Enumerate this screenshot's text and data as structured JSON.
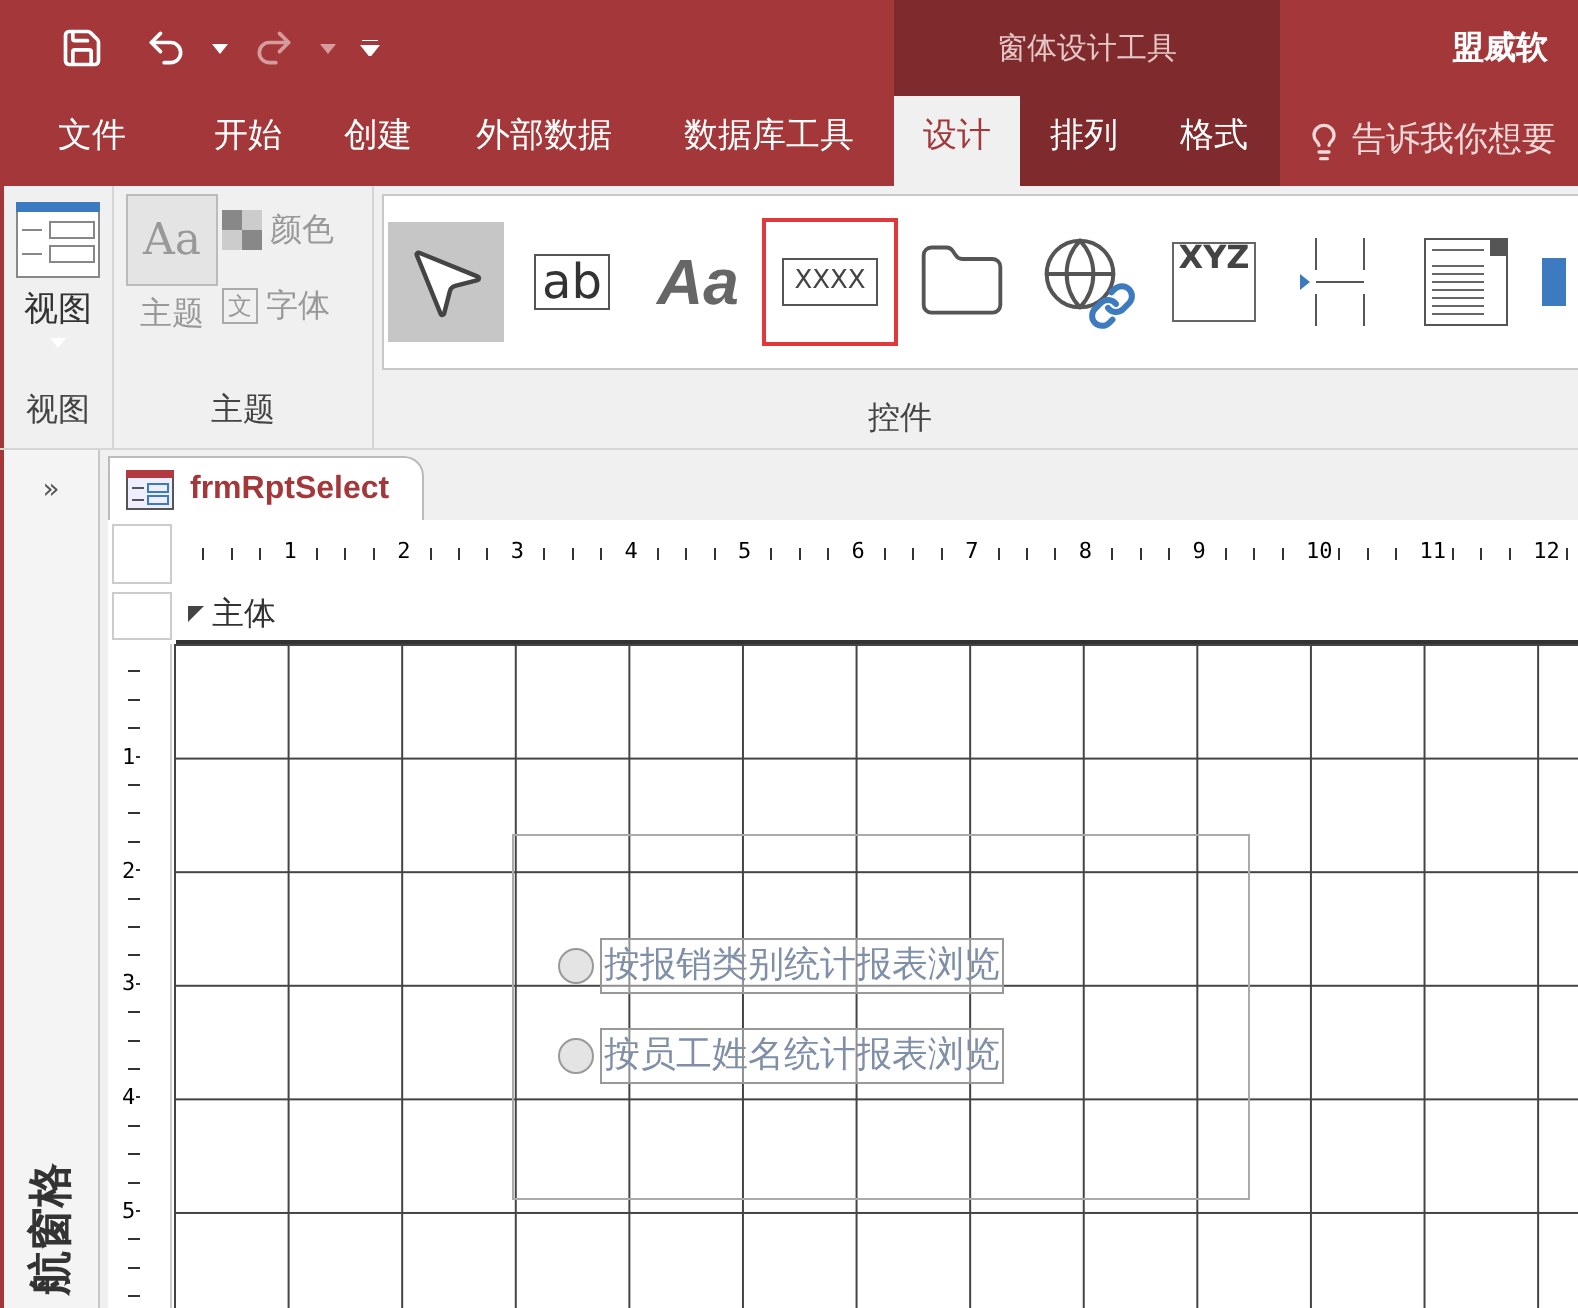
{
  "title_bar": {
    "context_header": "窗体设计工具",
    "app_title": "盟威软",
    "redo_disabled": true
  },
  "tabs": [
    {
      "label": "文件",
      "selected": false,
      "contextual": false
    },
    {
      "label": "开始",
      "selected": false,
      "contextual": false
    },
    {
      "label": "创建",
      "selected": false,
      "contextual": false
    },
    {
      "label": "外部数据",
      "selected": false,
      "contextual": false
    },
    {
      "label": "数据库工具",
      "selected": false,
      "contextual": false
    },
    {
      "label": "设计",
      "selected": true,
      "contextual": true
    },
    {
      "label": "排列",
      "selected": false,
      "contextual": true
    },
    {
      "label": "格式",
      "selected": false,
      "contextual": true
    }
  ],
  "tell_me": {
    "placeholder": "告诉我你想要"
  },
  "ribbon": {
    "view_group": {
      "button": "视图",
      "label": "视图"
    },
    "theme_group": {
      "theme_glyph": "Aa",
      "theme_button": "主题",
      "colors": "颜色",
      "fonts": "字体",
      "font_glyph": "文",
      "label": "主题",
      "disabled": true
    },
    "controls_group": {
      "label": "控件",
      "items": [
        {
          "kind": "pointer",
          "selected": true,
          "highlighted": false
        },
        {
          "kind": "textbox",
          "glyph": "ab",
          "selected": false,
          "highlighted": false
        },
        {
          "kind": "label",
          "glyph": "Aa",
          "selected": false,
          "highlighted": false
        },
        {
          "kind": "button",
          "glyph": "XXXX",
          "selected": false,
          "highlighted": true
        },
        {
          "kind": "tab",
          "selected": false,
          "highlighted": false
        },
        {
          "kind": "hyperlink",
          "selected": false,
          "highlighted": false
        },
        {
          "kind": "frame",
          "glyph": "XYZ",
          "selected": false,
          "highlighted": false
        },
        {
          "kind": "pagebreak",
          "selected": false,
          "highlighted": false
        },
        {
          "kind": "listbox",
          "selected": false,
          "highlighted": false
        },
        {
          "kind": "more",
          "selected": false,
          "highlighted": false
        }
      ]
    }
  },
  "nav_pane": {
    "title": "航窗格",
    "toggle": "»"
  },
  "document_tab": {
    "title": "frmRptSelect"
  },
  "ruler": {
    "marks": [
      "1",
      "2",
      "3",
      "4",
      "5",
      "6",
      "7",
      "8",
      "9",
      "10",
      "11",
      "12"
    ],
    "vertical_marks": [
      "1",
      "2",
      "3",
      "4",
      "5"
    ]
  },
  "section": {
    "title": "主体"
  },
  "option_group": {
    "options": [
      {
        "label": "按报销类别统计报表浏览",
        "selected": false
      },
      {
        "label": "按员工姓名统计报表浏览",
        "selected": false
      }
    ]
  }
}
